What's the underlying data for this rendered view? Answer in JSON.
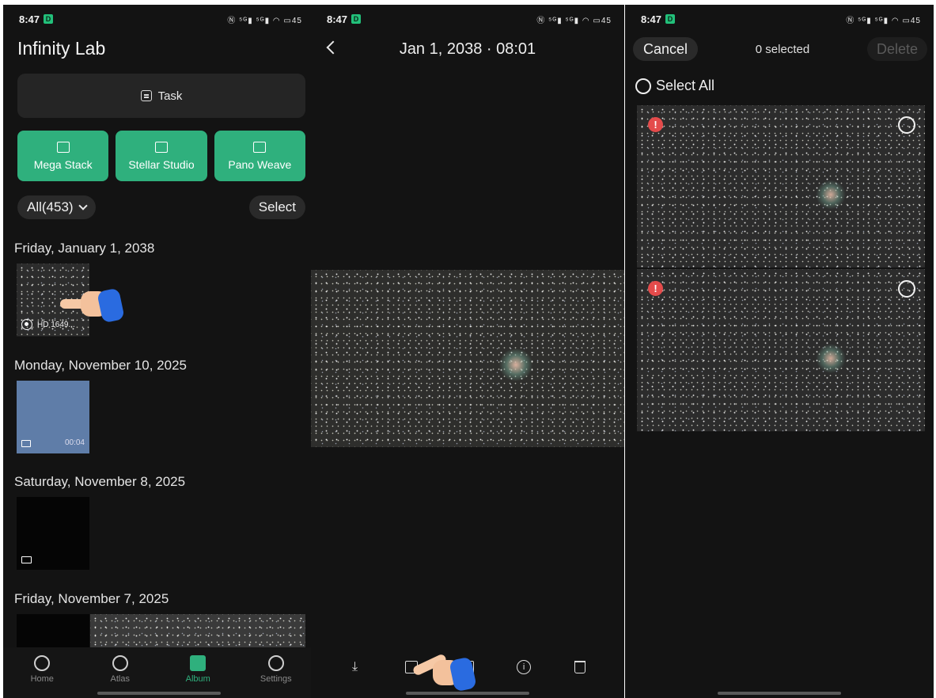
{
  "status_bar": {
    "time": "8:47",
    "badge": "D",
    "icons": "Ⓝ ⁵ᴳ▮ ⁵ᴳ▮ ◠ ▭45"
  },
  "album_screen": {
    "title": "Infinity Lab",
    "task_label": "Task",
    "features": [
      {
        "label": "Mega Stack",
        "icon": "stack-icon"
      },
      {
        "label": "Stellar Studio",
        "icon": "image-edit-icon"
      },
      {
        "label": "Pano Weave",
        "icon": "panorama-icon"
      }
    ],
    "filter_label": "All(453)",
    "select_label": "Select",
    "groups": [
      {
        "date": "Friday, January 1, 2038",
        "caption": "HD 1649..."
      },
      {
        "date": "Monday, November 10, 2025",
        "duration": "00:04"
      },
      {
        "date": "Saturday, November 8, 2025"
      },
      {
        "date": "Friday, November 7, 2025"
      }
    ],
    "tabs": [
      {
        "label": "Home",
        "icon": "planet-icon"
      },
      {
        "label": "Atlas",
        "icon": "constellation-icon"
      },
      {
        "label": "Album",
        "icon": "image-icon",
        "active": true
      },
      {
        "label": "Settings",
        "icon": "gear-icon"
      }
    ],
    "accent_color": "#2fb07d"
  },
  "viewer_screen": {
    "title": "Jan 1, 2038 · 08:01",
    "tools": [
      "download-icon",
      "copy-icon",
      "edit-image-icon",
      "info-icon",
      "trash-icon"
    ]
  },
  "select_screen": {
    "cancel_label": "Cancel",
    "selected_count": "0 selected",
    "delete_label": "Delete",
    "select_all_label": "Select All",
    "warning_color": "#e44b4b"
  }
}
